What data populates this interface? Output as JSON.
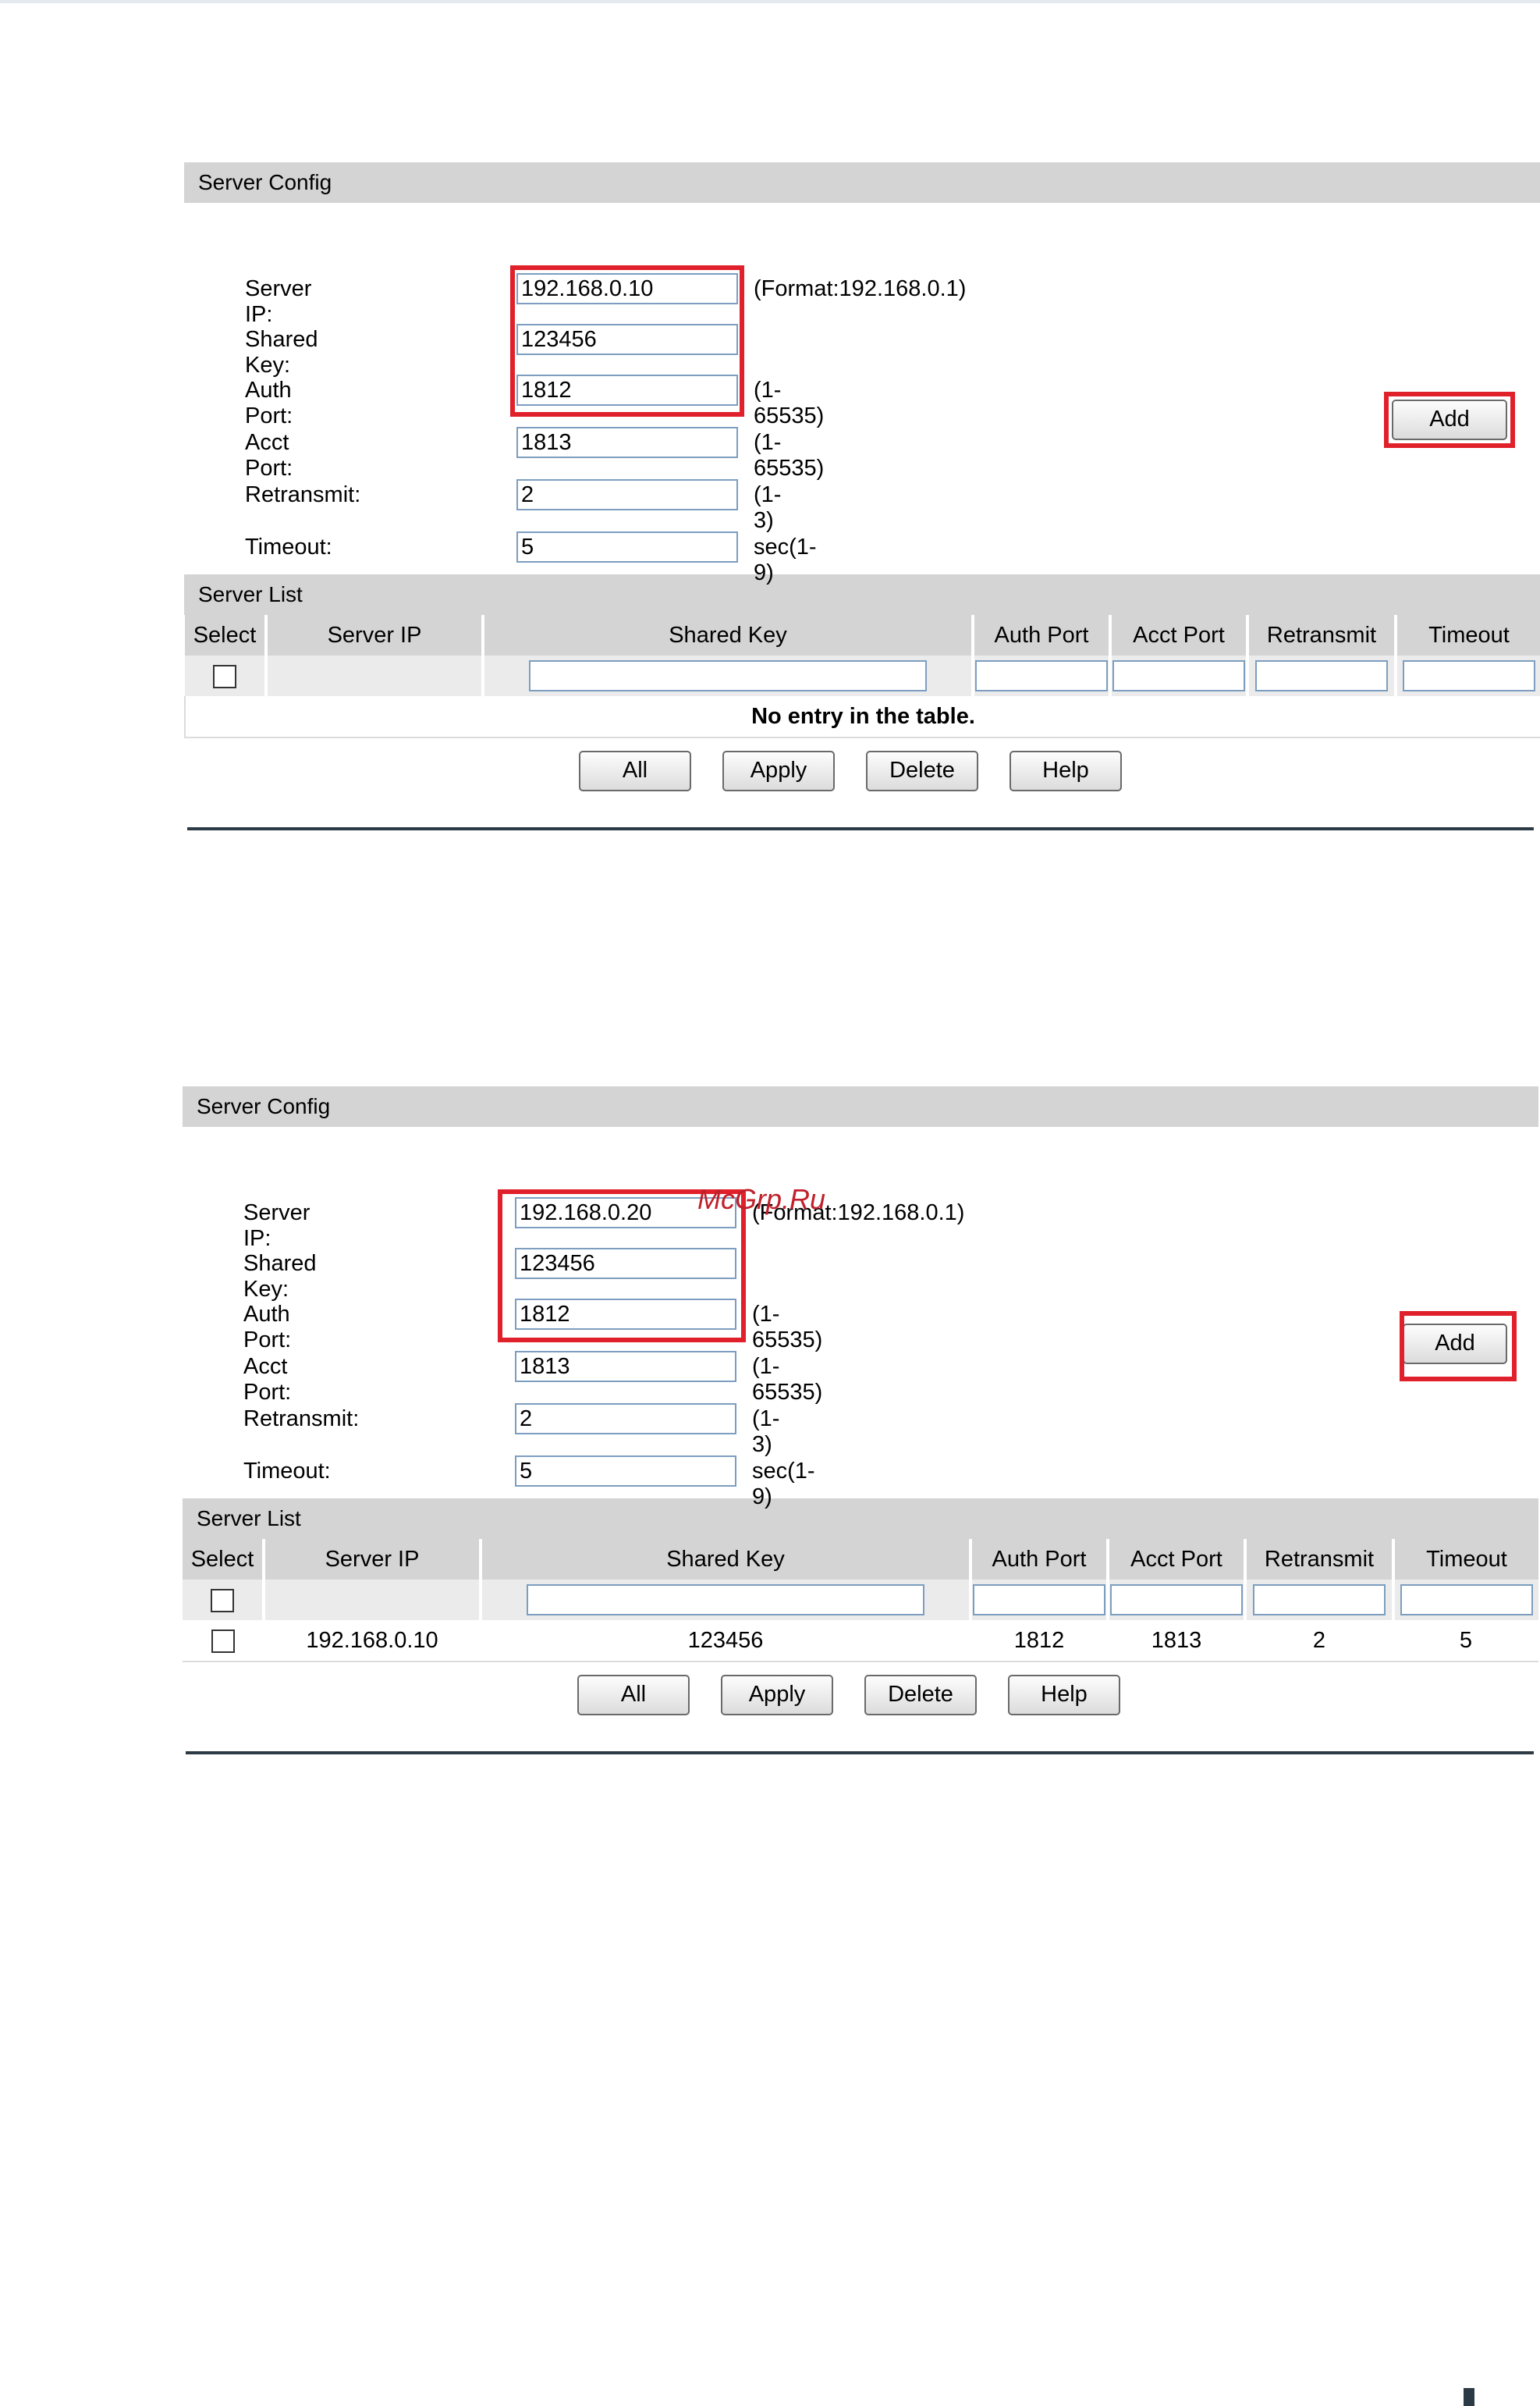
{
  "panels": [
    {
      "server_config": {
        "title": "Server Config",
        "server_ip": {
          "label": "Server IP:",
          "value": "192.168.0.10",
          "hint": "(Format:192.168.0.1)"
        },
        "shared_key": {
          "label": "Shared Key:",
          "value": "123456"
        },
        "auth_port": {
          "label": "Auth Port:",
          "value": "1812",
          "hint": "(1-65535)"
        },
        "acct_port": {
          "label": "Acct Port:",
          "value": "1813",
          "hint": "(1-65535)"
        },
        "retransmit": {
          "label": "Retransmit:",
          "value": "2",
          "hint": "(1-3)"
        },
        "timeout": {
          "label": "Timeout:",
          "value": "5",
          "hint": "sec(1-9)"
        },
        "add_label": "Add"
      },
      "server_list": {
        "title": "Server List",
        "columns": [
          "Select",
          "Server IP",
          "Shared Key",
          "Auth Port",
          "Acct Port",
          "Retransmit",
          "Timeout"
        ],
        "empty_message": "No entry in the table.",
        "rows": []
      },
      "buttons": {
        "all": "All",
        "apply": "Apply",
        "delete": "Delete",
        "help": "Help"
      }
    },
    {
      "server_config": {
        "title": "Server Config",
        "server_ip": {
          "label": "Server IP:",
          "value": "192.168.0.20",
          "hint": "(Format:192.168.0.1)"
        },
        "shared_key": {
          "label": "Shared Key:",
          "value": "123456"
        },
        "auth_port": {
          "label": "Auth Port:",
          "value": "1812",
          "hint": "(1-65535)"
        },
        "acct_port": {
          "label": "Acct Port:",
          "value": "1813",
          "hint": "(1-65535)"
        },
        "retransmit": {
          "label": "Retransmit:",
          "value": "2",
          "hint": "(1-3)"
        },
        "timeout": {
          "label": "Timeout:",
          "value": "5",
          "hint": "sec(1-9)"
        },
        "add_label": "Add"
      },
      "server_list": {
        "title": "Server List",
        "columns": [
          "Select",
          "Server IP",
          "Shared Key",
          "Auth Port",
          "Acct Port",
          "Retransmit",
          "Timeout"
        ],
        "rows": [
          {
            "server_ip": "192.168.0.10",
            "shared_key": "123456",
            "auth_port": "1812",
            "acct_port": "1813",
            "retransmit": "2",
            "timeout": "5"
          }
        ]
      },
      "buttons": {
        "all": "All",
        "apply": "Apply",
        "delete": "Delete",
        "help": "Help"
      }
    }
  ],
  "watermark": "McGrp.Ru",
  "colors": {
    "highlight": "#e0202a",
    "section_header": "#d4d4d4",
    "input_border": "#7d9ec0"
  }
}
